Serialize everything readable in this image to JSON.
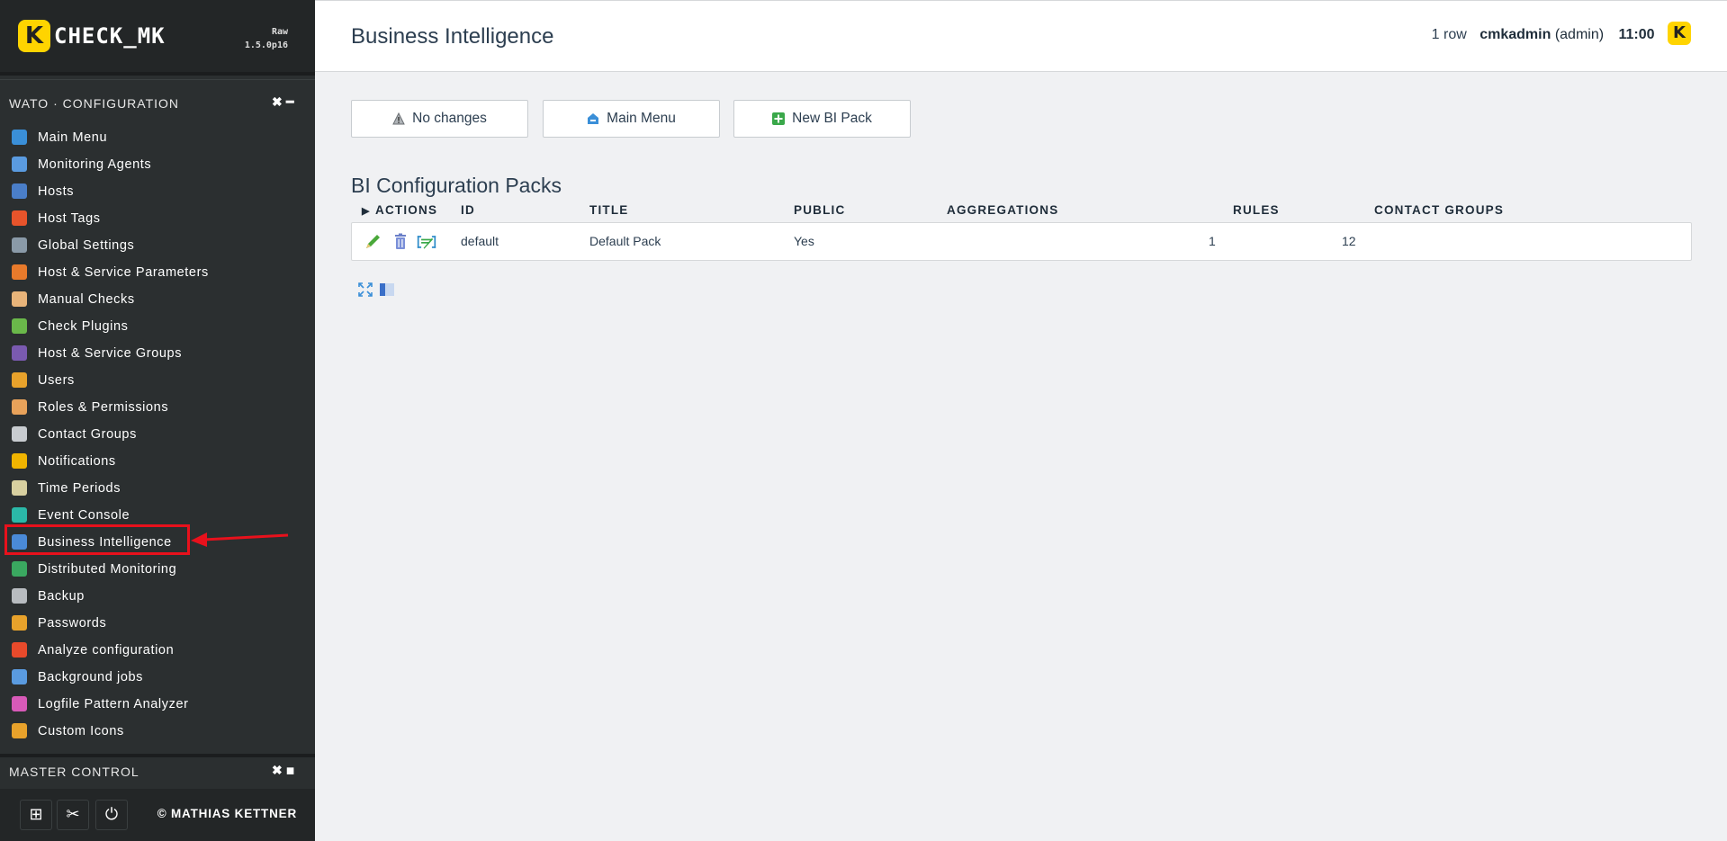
{
  "app": {
    "logo_mark": "K",
    "logo_text": "CHECK_MK",
    "edition_line1": "Raw",
    "edition_line2": "1.5.0p16"
  },
  "sidebar": {
    "wato_snapin": {
      "title": "WATO · CONFIGURATION",
      "close_glyph": "✖",
      "minimize_glyph": "━",
      "items": [
        {
          "label": "Main Menu",
          "icon": "home-icon",
          "color": "#3a8fd8"
        },
        {
          "label": "Monitoring Agents",
          "icon": "agents-icon",
          "color": "#5a9be0"
        },
        {
          "label": "Hosts",
          "icon": "hosts-icon",
          "color": "#4a7ec8"
        },
        {
          "label": "Host Tags",
          "icon": "tag-icon",
          "color": "#e8542b"
        },
        {
          "label": "Global Settings",
          "icon": "gear-icon",
          "color": "#8a9aa8"
        },
        {
          "label": "Host & Service Parameters",
          "icon": "rulesets-icon",
          "color": "#e87a2b"
        },
        {
          "label": "Manual Checks",
          "icon": "hand-icon",
          "color": "#e8b47a"
        },
        {
          "label": "Check Plugins",
          "icon": "puzzle-icon",
          "color": "#6ab84a"
        },
        {
          "label": "Host & Service Groups",
          "icon": "groups-icon",
          "color": "#7a5ab0"
        },
        {
          "label": "Users",
          "icon": "users-icon",
          "color": "#e8a22b"
        },
        {
          "label": "Roles & Permissions",
          "icon": "roles-icon",
          "color": "#e8a25a"
        },
        {
          "label": "Contact Groups",
          "icon": "contact-groups-icon",
          "color": "#c8ccd0"
        },
        {
          "label": "Notifications",
          "icon": "bell-icon",
          "color": "#f0b400"
        },
        {
          "label": "Time Periods",
          "icon": "clock-icon",
          "color": "#d8d0a0"
        },
        {
          "label": "Event Console",
          "icon": "event-console-icon",
          "color": "#2bb8a8"
        },
        {
          "label": "Business Intelligence",
          "icon": "bi-icon",
          "color": "#4a8ad8"
        },
        {
          "label": "Distributed Monitoring",
          "icon": "globe-icon",
          "color": "#3aa860"
        },
        {
          "label": "Backup",
          "icon": "backup-icon",
          "color": "#b8bcc0"
        },
        {
          "label": "Passwords",
          "icon": "key-icon",
          "color": "#e8a22b"
        },
        {
          "label": "Analyze configuration",
          "icon": "heart-check-icon",
          "color": "#e84a2b"
        },
        {
          "label": "Background jobs",
          "icon": "jobs-icon",
          "color": "#5a9be0"
        },
        {
          "label": "Logfile Pattern Analyzer",
          "icon": "flask-icon",
          "color": "#d85ab8"
        },
        {
          "label": "Custom Icons",
          "icon": "custom-icons-icon",
          "color": "#e8a22b"
        }
      ]
    },
    "master_control": {
      "title": "MASTER CONTROL",
      "close_glyph": "✖",
      "maximize_glyph": "◼"
    },
    "footer": {
      "add_snapin_glyph": "⊞",
      "settings_glyph": "✂",
      "logout_glyph": "⏻",
      "copyright": "© MATHIAS KETTNER"
    }
  },
  "header": {
    "title": "Business Intelligence",
    "row_count": "1 row",
    "username": "cmkadmin",
    "role": "(admin)",
    "clock": "11:00",
    "logo_mark": "K"
  },
  "buttons": {
    "no_changes": "No changes",
    "main_menu": "Main Menu",
    "new_bi_pack": "New BI Pack"
  },
  "table": {
    "title": "BI Configuration Packs",
    "toggle_glyph": "▶",
    "columns": [
      "ACTIONS",
      "ID",
      "TITLE",
      "PUBLIC",
      "AGGREGATIONS",
      "RULES",
      "CONTACT GROUPS"
    ],
    "rows": [
      {
        "id": "default",
        "title": "Default Pack",
        "public": "Yes",
        "aggregations": "1",
        "rules": "12",
        "contact_groups": ""
      }
    ]
  }
}
